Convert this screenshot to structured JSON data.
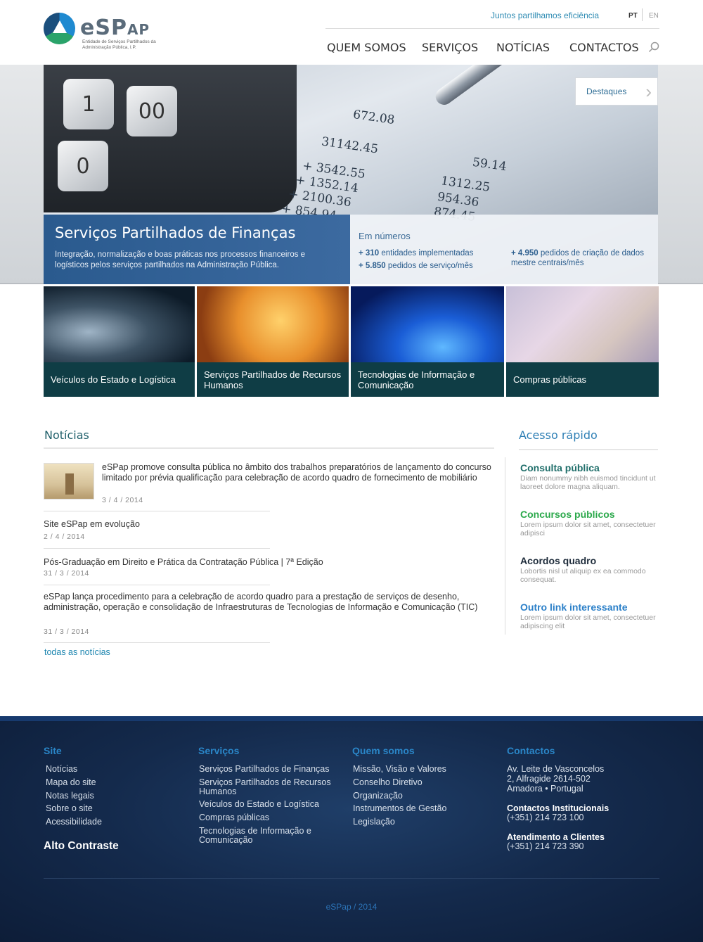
{
  "header": {
    "logo_name": "eSP",
    "logo_name_suffix": "AP",
    "logo_subtitle": "Entidade de Serviços Partilhados da Administração Pública, I.P.",
    "tagline": "Juntos partilhamos eficiência",
    "lang_pt": "PT",
    "lang_en": "EN",
    "nav": [
      "QUEM SOMOS",
      "SERVIÇOS",
      "NOTÍCIAS",
      "CONTACTOS"
    ]
  },
  "hero": {
    "destaques": "Destaques",
    "title": "Serviços Partilhados de Finanças",
    "description": "Integração, normalização e boas práticas nos processos financeiros e logísticos pelos serviços partilhados na Administração Pública.",
    "stats_title": "Em números",
    "stats": [
      {
        "value": "+ 310",
        "label": "entidades implementadas"
      },
      {
        "value": "+ 5.850",
        "label": "pedidos de serviço/mês"
      },
      {
        "value": "+ 4.950",
        "label": "pedidos de criação de dados mestre centrais/mês"
      }
    ],
    "calc_keys": [
      "1",
      "00",
      "0"
    ],
    "paper_numbers": [
      "31142.45",
      "+ 3542.55",
      "+ 1352.14",
      "+ 2100.36",
      "+ 854.94",
      "1312.25",
      "954.36",
      "874.45",
      "59.14",
      "672.08"
    ]
  },
  "tiles": [
    {
      "label": "Veículos do Estado e Logística"
    },
    {
      "label": "Serviços Partilhados de Recursos Humanos"
    },
    {
      "label": "Tecnologias de Informação e Comunicação"
    },
    {
      "label": "Compras públicas"
    }
  ],
  "news": {
    "title": "Notícias",
    "items": [
      {
        "text": "eSPap promove consulta pública no âmbito dos trabalhos preparatórios de lançamento do concurso limitado por prévia qualificação para celebração de acordo quadro de fornecimento de mobiliário",
        "date": "3 / 4 / 2014"
      },
      {
        "text": "Site eSPap em evolução",
        "date": "2 / 4 / 2014"
      },
      {
        "text": "Pós-Graduação em Direito e Prática da Contratação Pública | 7ª Edição",
        "date": "31 / 3 / 2014"
      },
      {
        "text": "eSPap lança procedimento para a celebração de acordo quadro para a prestação de serviços de desenho, administração, operação e consolidação de Infraestruturas de Tecnologias de Informação e Comunicação (TIC)",
        "date": "31 / 3 / 2014"
      }
    ],
    "all_link": "todas as notícias"
  },
  "quick_access": {
    "title": "Acesso rápido",
    "links": [
      {
        "label": "Consulta pública",
        "desc": "Diam nonummy nibh euismod tincidunt ut laoreet dolore magna aliquam.",
        "color": "#1f6e6a"
      },
      {
        "label": "Concursos públicos",
        "desc": "Lorem ipsum dolor sit amet, consectetuer adipisci",
        "color": "#2aa84a"
      },
      {
        "label": "Acordos quadro",
        "desc": "Lobortis nisl ut aliquip ex ea commodo consequat.",
        "color": "#1d2b3a"
      },
      {
        "label": "Outro link interessante",
        "desc": "Lorem ipsum dolor sit amet, consectetuer adipiscing elit",
        "color": "#2a7fc8"
      }
    ]
  },
  "footer": {
    "site": {
      "title": "Site",
      "links": [
        "Notícias",
        "Mapa do site",
        "Notas legais",
        "Sobre o site",
        "Acessibilidade"
      ]
    },
    "alto_contraste": "Alto Contraste",
    "servicos": {
      "title": "Serviços",
      "links": [
        "Serviços Partilhados de Finanças",
        "Serviços Partilhados de Recursos Humanos",
        "Veículos do Estado e Logística",
        "Compras públicas",
        "Tecnologias de Informação e Comunicação"
      ]
    },
    "quem_somos": {
      "title": "Quem somos",
      "links": [
        "Missão, Visão e Valores",
        "Conselho Diretivo",
        "Organização",
        "Instrumentos de Gestão",
        "Legislação"
      ]
    },
    "contactos": {
      "title": "Contactos",
      "address": [
        "Av. Leite de Vasconcelos",
        "2, Alfragide 2614-502",
        "Amadora • Portugal"
      ],
      "institucionais_label": "Contactos Institucionais",
      "institucionais_phone": "(+351) 214 723 100",
      "clientes_label": "Atendimento a Clientes",
      "clientes_phone": "(+351) 214 723 390"
    },
    "copyright": "eSPap / 2014"
  }
}
